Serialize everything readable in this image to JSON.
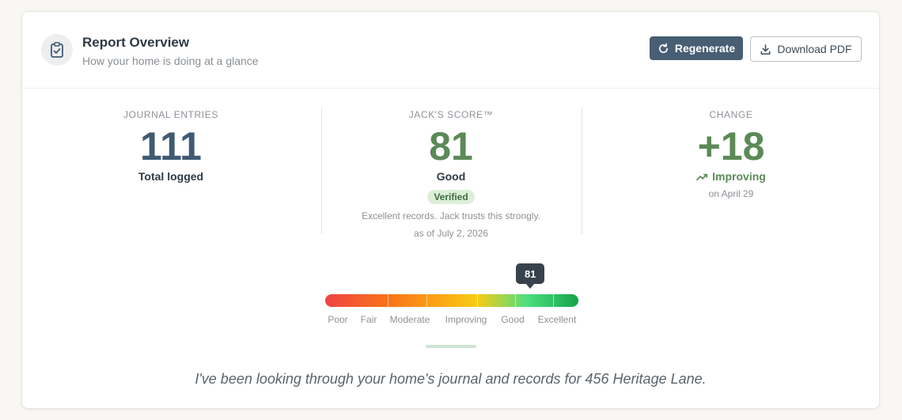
{
  "header": {
    "title": "Report Overview",
    "subtitle": "How your home is doing at a glance",
    "icon": "clipboard-check-icon",
    "regenerate_label": "Regenerate",
    "download_label": "Download PDF",
    "accent": "#485e73"
  },
  "stats": {
    "entries": {
      "label": "JOURNAL ENTRIES",
      "value": "111",
      "caption": "Total logged",
      "color": "#3f5b73"
    },
    "score": {
      "label": "JACK'S SCORE™",
      "value": "81",
      "caption": "Good",
      "badge": "Verified",
      "note": "Excellent records. Jack trusts this strongly.",
      "date": "as of July 2, 2026",
      "color": "#5b8a57"
    },
    "change": {
      "label": "CHANGE",
      "value": "+18",
      "trend": "Improving",
      "date": "on April 29",
      "color": "#5b8a57"
    }
  },
  "scale": {
    "value": "81",
    "value_fraction": 0.81,
    "labels": [
      "Poor",
      "Fair",
      "Moderate",
      "Improving",
      "Good",
      "Excellent"
    ]
  },
  "quote": "I've been looking through your home's journal and records for 456 Heritage Lane."
}
